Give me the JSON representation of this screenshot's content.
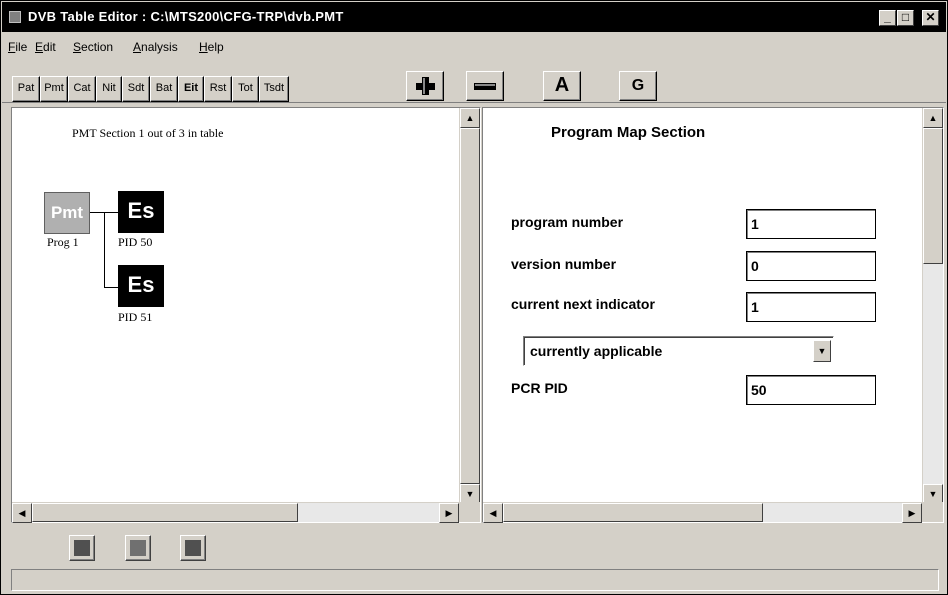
{
  "window": {
    "title": "DVB Table Editor : C:\\MTS200\\CFG-TRP\\dvb.PMT",
    "controls": {
      "minimize": "_",
      "maximize": "□",
      "close": "✕"
    }
  },
  "menu": [
    {
      "label": "File",
      "key": "F",
      "rest": "ile"
    },
    {
      "label": "Edit",
      "key": "E",
      "rest": "dit"
    },
    {
      "label": "Section",
      "key": "S",
      "rest": "ection"
    },
    {
      "label": "Analysis",
      "key": "A",
      "rest": "nalysis"
    },
    {
      "label": "Help",
      "key": "H",
      "rest": "elp"
    }
  ],
  "toolbar": {
    "table_buttons": [
      "Pat",
      "Pmt",
      "Cat",
      "Nit",
      "Sdt",
      "Bat",
      "Eit",
      "Rst",
      "Tot",
      "Tsdt"
    ],
    "add_icon": "plus-icon",
    "remove_icon": "minus-icon",
    "a_label": "A",
    "g_label": "G"
  },
  "tree": {
    "caption": "PMT Section 1 out of 3 in table",
    "pmt_node": {
      "label": "Pmt",
      "caption": "Prog 1"
    },
    "es_nodes": [
      {
        "label": "Es",
        "caption": "PID 50"
      },
      {
        "label": "Es",
        "caption": "PID 51"
      }
    ]
  },
  "form": {
    "title": "Program Map Section",
    "program_number": {
      "label": "program number",
      "value": "1"
    },
    "version_number": {
      "label": "version number",
      "value": "0"
    },
    "current_next_indicator": {
      "label": "current next indicator",
      "value": "1"
    },
    "applicability": {
      "selected": "currently applicable"
    },
    "pcr_pid": {
      "label": "PCR PID",
      "value": "50"
    }
  },
  "bottom_nav": [
    "first-section-icon",
    "info-icon",
    "last-section-icon"
  ],
  "colors": {
    "titlebar": "#000000",
    "face": "#d4d0c8",
    "pmt_node": "#b0b0b0",
    "es_node": "#000000"
  }
}
